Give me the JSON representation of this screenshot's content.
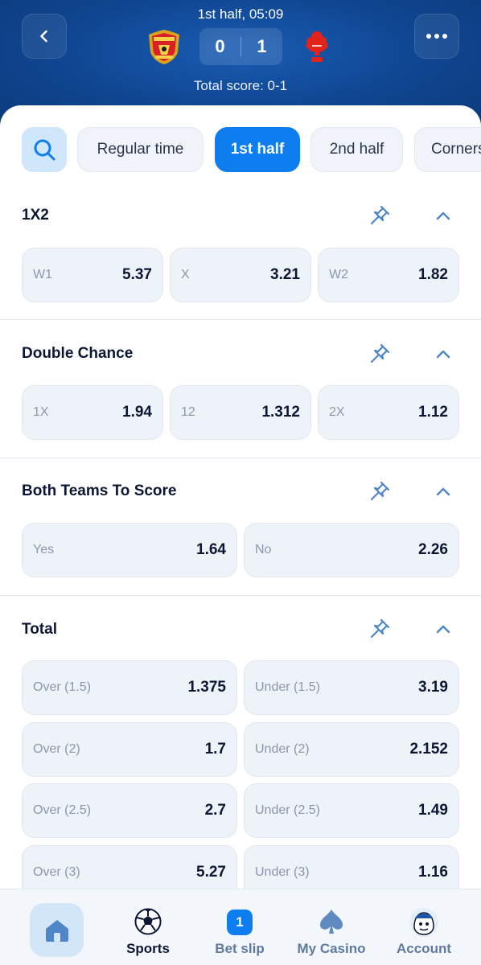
{
  "header": {
    "status": "1st half, 05:09",
    "home_score": "0",
    "away_score": "1",
    "total": "Total score: 0-1",
    "home_crest": "manchester-united-crest",
    "away_crest": "nottingham-forest-crest"
  },
  "filters": {
    "tabs": [
      "Regular time",
      "1st half",
      "2nd half",
      "Corners"
    ],
    "active": "1st half"
  },
  "markets": [
    {
      "title": "1X2",
      "odds": [
        {
          "label": "W1",
          "value": "5.37"
        },
        {
          "label": "X",
          "value": "3.21"
        },
        {
          "label": "W2",
          "value": "1.82"
        }
      ]
    },
    {
      "title": "Double Chance",
      "odds": [
        {
          "label": "1X",
          "value": "1.94"
        },
        {
          "label": "12",
          "value": "1.312"
        },
        {
          "label": "2X",
          "value": "1.12"
        }
      ]
    },
    {
      "title": "Both Teams To Score",
      "odds": [
        {
          "label": "Yes",
          "value": "1.64"
        },
        {
          "label": "No",
          "value": "2.26"
        }
      ]
    },
    {
      "title": "Total",
      "odds": [
        {
          "label": "Over (1.5)",
          "value": "1.375"
        },
        {
          "label": "Under (1.5)",
          "value": "3.19"
        },
        {
          "label": "Over (2)",
          "value": "1.7"
        },
        {
          "label": "Under (2)",
          "value": "2.152"
        },
        {
          "label": "Over (2.5)",
          "value": "2.7"
        },
        {
          "label": "Under (2.5)",
          "value": "1.49"
        },
        {
          "label": "Over (3)",
          "value": "5.27"
        },
        {
          "label": "Under (3)",
          "value": "1.16"
        }
      ]
    }
  ],
  "nav": {
    "sports": "Sports",
    "bet_slip": "Bet slip",
    "bet_slip_count": "1",
    "my_casino": "My Casino",
    "account": "Account"
  },
  "colors": {
    "header_bg": "#0f4590",
    "accent": "#0d7df0",
    "odd_bg": "#eef3f9"
  }
}
